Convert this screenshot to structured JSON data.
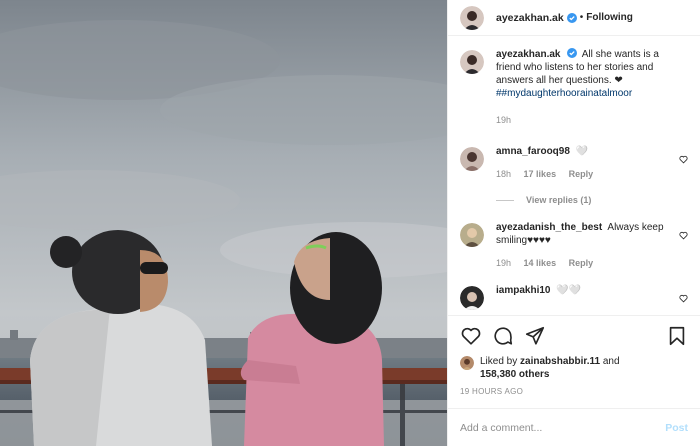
{
  "post": {
    "username": "ayezakhan.ak",
    "verified": true,
    "separator": "•",
    "follow_status": "Following"
  },
  "caption": {
    "username": "ayezakhan.ak",
    "text": "All she wants is a friend who listens to her stories and answers all her questions. ❤",
    "hashtag": "##mydaughterhoorainatalmoor",
    "time": "19h"
  },
  "comments": [
    {
      "username": "amna_farooq98",
      "text": "🤍",
      "time": "18h",
      "likes": "17 likes",
      "reply": "Reply",
      "view_replies": "View replies (1)"
    },
    {
      "username": "ayezadanish_the_best",
      "text": "Always keep smiling♥♥♥♥",
      "time": "19h",
      "likes": "14 likes",
      "reply": "Reply"
    },
    {
      "username": "iampakhi10",
      "text": "🤍🤍"
    }
  ],
  "likes": {
    "prefix": "Liked by",
    "user": "zainabshabbir.11",
    "joiner": "and",
    "others": "158,380 others"
  },
  "timestamp": "19 HOURS AGO",
  "add_comment": {
    "placeholder": "Add a comment...",
    "post_label": "Post"
  },
  "colors": {
    "link": "#00376b",
    "verified": "#3897f0",
    "muted": "#8e8e8e",
    "post_disabled": "#b2dffc"
  },
  "icons": [
    "heart-icon",
    "comment-icon",
    "share-icon",
    "bookmark-icon",
    "verified-icon"
  ]
}
